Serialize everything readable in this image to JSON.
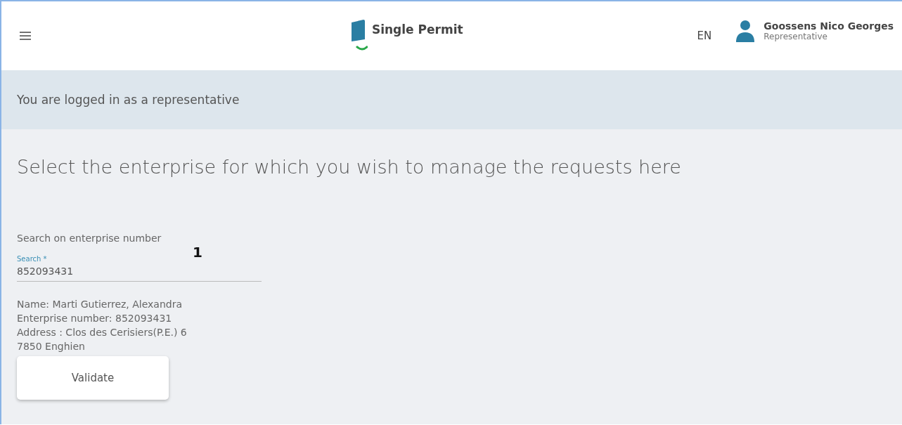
{
  "header": {
    "app_name": "Single Permit",
    "language": "EN",
    "user": {
      "name": "Goossens Nico Georges",
      "role": "Representative"
    }
  },
  "banner": {
    "text": "You are logged in as a representative"
  },
  "main": {
    "heading": "Select the enterprise for which you wish to manage the requests here",
    "search_label": "Search on enterprise number",
    "search_field": {
      "label": "Search *",
      "value": "852093431"
    },
    "details": [
      "Name: Marti Gutierrez, Alexandra",
      "Enterprise number: 852093431",
      "Address : Clos des Cerisiers(P.E.) 6",
      "7850 Enghien"
    ],
    "validate_button": "Validate",
    "annotation": "1"
  }
}
